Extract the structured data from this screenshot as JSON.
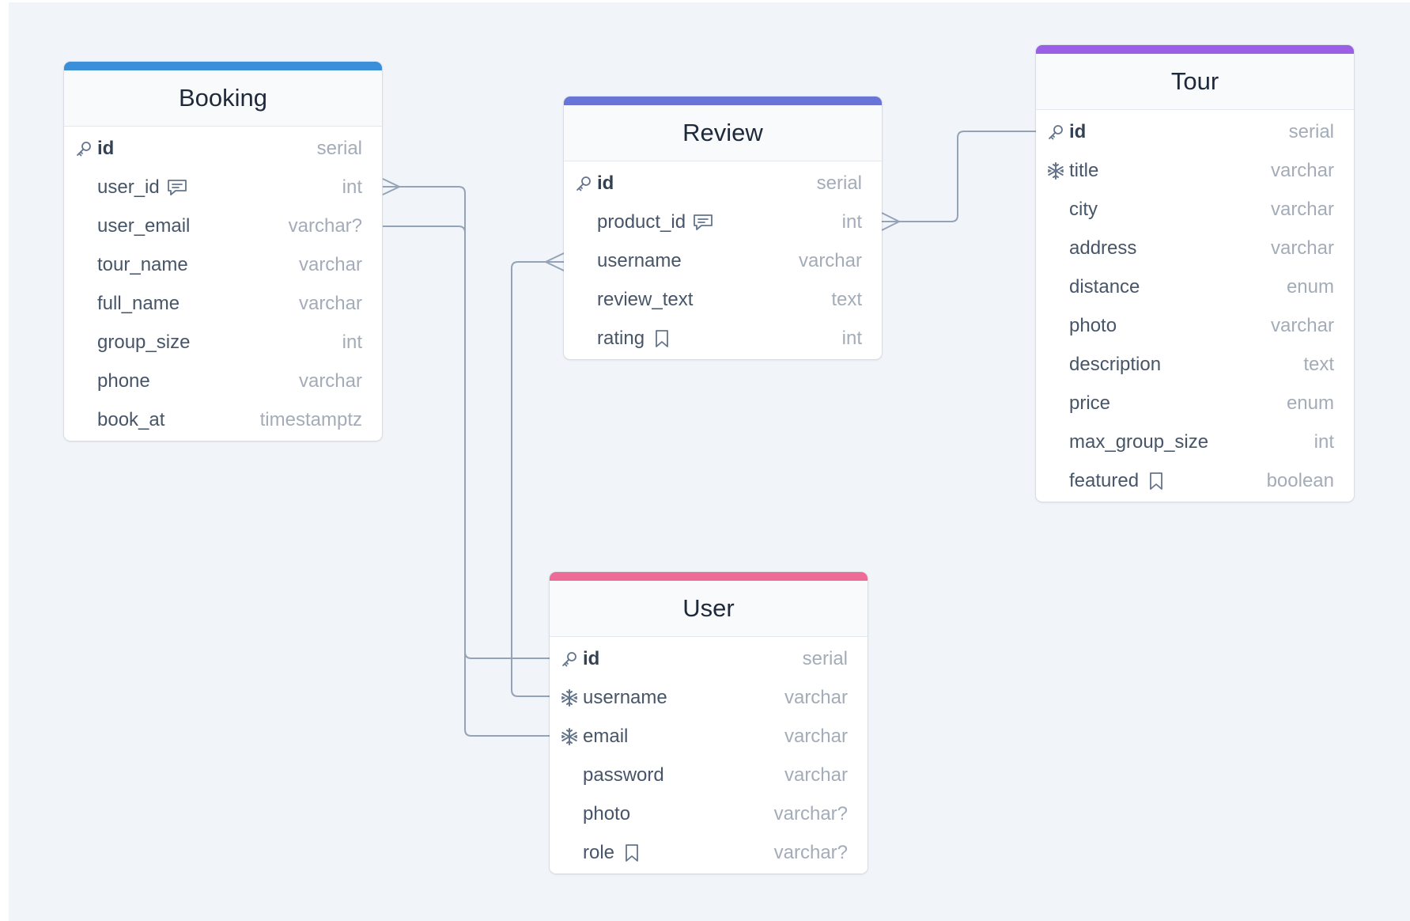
{
  "colors": {
    "background": "#f1f5f9",
    "booking_accent": "#3b8fd9",
    "review_accent": "#6875d6",
    "tour_accent": "#9a5fe6",
    "user_accent": "#ec6b97",
    "relation_line": "#94a3b8"
  },
  "entities": {
    "booking": {
      "name": "Booking",
      "fields": [
        {
          "name": "id",
          "type": "serial",
          "icon": "key-icon"
        },
        {
          "name": "user_id",
          "type": "int",
          "icon": "comment-icon"
        },
        {
          "name": "user_email",
          "type": "varchar?"
        },
        {
          "name": "tour_name",
          "type": "varchar"
        },
        {
          "name": "full_name",
          "type": "varchar"
        },
        {
          "name": "group_size",
          "type": "int"
        },
        {
          "name": "phone",
          "type": "varchar"
        },
        {
          "name": "book_at",
          "type": "timestamptz"
        }
      ]
    },
    "review": {
      "name": "Review",
      "fields": [
        {
          "name": "id",
          "type": "serial",
          "icon": "key-icon"
        },
        {
          "name": "product_id",
          "type": "int",
          "icon": "comment-icon"
        },
        {
          "name": "username",
          "type": "varchar"
        },
        {
          "name": "review_text",
          "type": "text"
        },
        {
          "name": "rating",
          "type": "int",
          "icon": "bookmark-icon"
        }
      ]
    },
    "tour": {
      "name": "Tour",
      "fields": [
        {
          "name": "id",
          "type": "serial",
          "icon": "key-icon"
        },
        {
          "name": "title",
          "type": "varchar",
          "icon": "snowflake-icon"
        },
        {
          "name": "city",
          "type": "varchar"
        },
        {
          "name": "address",
          "type": "varchar"
        },
        {
          "name": "distance",
          "type": "enum"
        },
        {
          "name": "photo",
          "type": "varchar"
        },
        {
          "name": "description",
          "type": "text"
        },
        {
          "name": "price",
          "type": "enum"
        },
        {
          "name": "max_group_size",
          "type": "int"
        },
        {
          "name": "featured",
          "type": "boolean",
          "icon": "bookmark-icon"
        }
      ]
    },
    "user": {
      "name": "User",
      "fields": [
        {
          "name": "id",
          "type": "serial",
          "icon": "key-icon"
        },
        {
          "name": "username",
          "type": "varchar",
          "icon": "snowflake-icon"
        },
        {
          "name": "email",
          "type": "varchar",
          "icon": "snowflake-icon"
        },
        {
          "name": "password",
          "type": "varchar"
        },
        {
          "name": "photo",
          "type": "varchar?"
        },
        {
          "name": "role",
          "type": "varchar?",
          "icon": "bookmark-icon"
        }
      ]
    }
  }
}
